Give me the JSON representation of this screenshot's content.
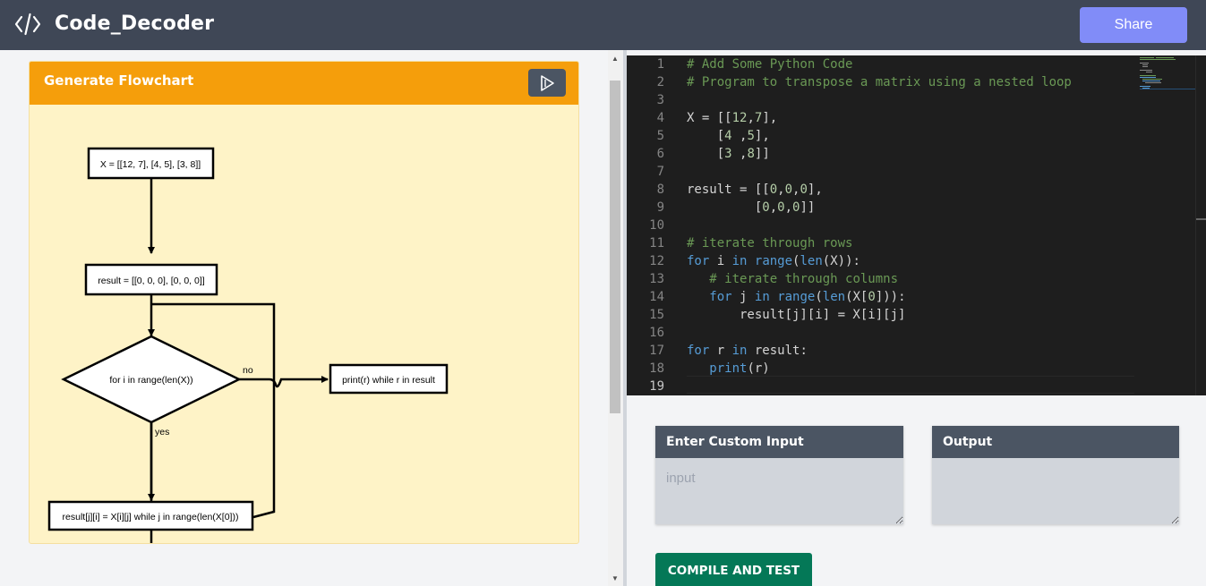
{
  "header": {
    "app_title": "Code_Decoder",
    "logo_icon": "code-brackets-icon",
    "share_label": "Share"
  },
  "flowchart": {
    "title": "Generate Flowchart",
    "run_icon": "play-outline-icon",
    "nodes": {
      "assign_x": "X = [[12, 7], [4, 5], [3, 8]]",
      "assign_result": "result = [[0, 0, 0], [0, 0, 0]]",
      "loop_decision": "for i in range(len(X))",
      "inner_body": "result[j][i] = X[i][j] while j in range(len(X[0]))",
      "print_step": "print(r) while r in result"
    },
    "edge_labels": {
      "no": "no",
      "yes": "yes"
    }
  },
  "editor": {
    "line_numbers": [
      "1",
      "2",
      "3",
      "4",
      "5",
      "6",
      "7",
      "8",
      "9",
      "10",
      "11",
      "12",
      "13",
      "14",
      "15",
      "16",
      "17",
      "18",
      "19"
    ],
    "lines": [
      "# Add Some Python Code",
      "# Program to transpose a matrix using a nested loop",
      "",
      "X = [[12,7],",
      "    [4 ,5],",
      "    [3 ,8]]",
      "",
      "result = [[0,0,0],",
      "         [0,0,0]]",
      "",
      "# iterate through rows",
      "for i in range(len(X)):",
      "   # iterate through columns",
      "   for j in range(len(X[0])):",
      "       result[j][i] = X[i][j]",
      "",
      "for r in result:",
      "   print(r)",
      ""
    ]
  },
  "custom_input": {
    "title": "Enter Custom Input",
    "placeholder": "input",
    "value": ""
  },
  "output": {
    "title": "Output",
    "value": ""
  },
  "compile_label": "COMPILE AND TEST",
  "colors": {
    "topbar": "#3f4756",
    "share": "#818cf8",
    "flowchart_header": "#f59e0b",
    "flowchart_body": "#fef3c7",
    "editor_bg": "#1e1e1e",
    "comment": "#6a9955",
    "keyword": "#569cd6",
    "builtin": "#4fc1ff",
    "number": "#b5cea8",
    "compile": "#047857"
  }
}
